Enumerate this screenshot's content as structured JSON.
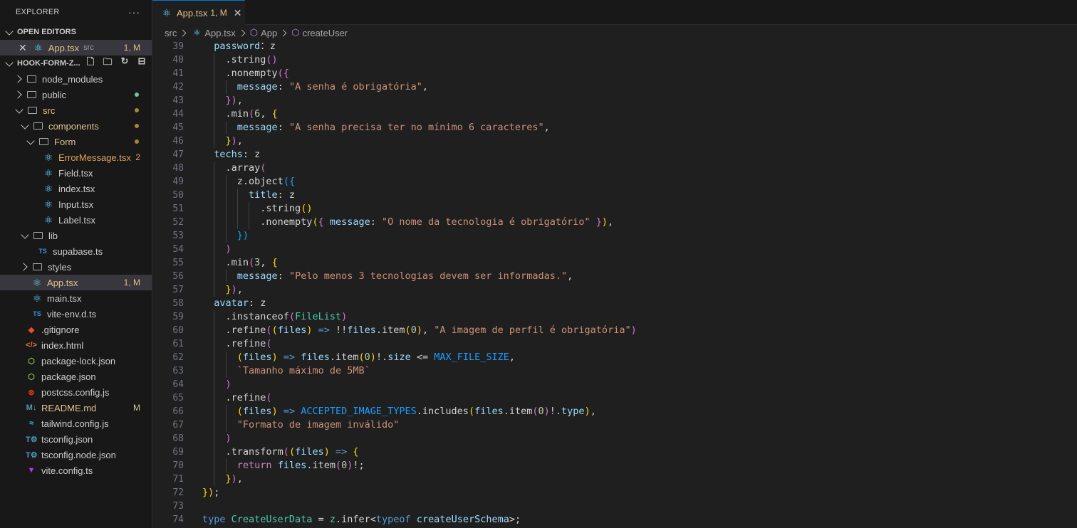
{
  "explorer": {
    "title": "EXPLORER",
    "more": "···",
    "open_editors": {
      "label": "OPEN EDITORS",
      "items": [
        {
          "name": "App.tsx",
          "dir": "src",
          "badge": "1, M"
        }
      ]
    },
    "project": {
      "label": "HOOK-FORM-Z...",
      "tree": [
        {
          "label": "node_modules",
          "depth": 0,
          "kind": "folder-collapsed"
        },
        {
          "label": "public",
          "depth": 0,
          "kind": "folder-collapsed",
          "dot": "#73c991"
        },
        {
          "label": "src",
          "depth": 0,
          "kind": "folder-open",
          "state": "mod",
          "dot": "#a8872f"
        },
        {
          "label": "components",
          "depth": 1,
          "kind": "folder-open",
          "state": "mod",
          "dot": "#a8872f"
        },
        {
          "label": "Form",
          "depth": 2,
          "kind": "folder-open",
          "state": "mod",
          "dot": "#a8872f"
        },
        {
          "label": "ErrorMessage.tsx",
          "depth": 3,
          "kind": "react",
          "state": "err",
          "badge": "2"
        },
        {
          "label": "Field.tsx",
          "depth": 3,
          "kind": "react"
        },
        {
          "label": "index.tsx",
          "depth": 3,
          "kind": "react"
        },
        {
          "label": "Input.tsx",
          "depth": 3,
          "kind": "react"
        },
        {
          "label": "Label.tsx",
          "depth": 3,
          "kind": "react"
        },
        {
          "label": "lib",
          "depth": 1,
          "kind": "folder-open"
        },
        {
          "label": "supabase.ts",
          "depth": 2,
          "kind": "ts",
          "icon": "TS"
        },
        {
          "label": "styles",
          "depth": 1,
          "kind": "folder-collapsed"
        },
        {
          "label": "App.tsx",
          "depth": 1,
          "kind": "react",
          "state": "mod",
          "badge": "1, M",
          "selected": true
        },
        {
          "label": "main.tsx",
          "depth": 1,
          "kind": "react"
        },
        {
          "label": "vite-env.d.ts",
          "depth": 1,
          "kind": "ts",
          "icon": "TS"
        },
        {
          "label": ".gitignore",
          "depth": 0,
          "kind": "file",
          "icon": "◆",
          "color": "#e24e33"
        },
        {
          "label": "index.html",
          "depth": 0,
          "kind": "file",
          "icon": "</>",
          "color": "#e37933"
        },
        {
          "label": "package-lock.json",
          "depth": 0,
          "kind": "file",
          "icon": "⬡",
          "color": "#8dc149"
        },
        {
          "label": "package.json",
          "depth": 0,
          "kind": "file",
          "icon": "⬡",
          "color": "#8dc149"
        },
        {
          "label": "postcss.config.js",
          "depth": 0,
          "kind": "file",
          "icon": "⊛",
          "color": "#dd3a0a"
        },
        {
          "label": "README.md",
          "depth": 0,
          "kind": "file",
          "icon": "M↓",
          "color": "#519aba",
          "state": "mod",
          "badge": "M"
        },
        {
          "label": "tailwind.config.js",
          "depth": 0,
          "kind": "file",
          "icon": "≈",
          "color": "#38bdf8"
        },
        {
          "label": "tsconfig.json",
          "depth": 0,
          "kind": "file",
          "icon": "T⚙",
          "color": "#519aba"
        },
        {
          "label": "tsconfig.node.json",
          "depth": 0,
          "kind": "file",
          "icon": "T⚙",
          "color": "#519aba"
        },
        {
          "label": "vite.config.ts",
          "depth": 0,
          "kind": "file",
          "icon": "▼",
          "color": "#bd34fe"
        }
      ]
    }
  },
  "tab": {
    "label": "App.tsx",
    "extra": "1, M",
    "close": "✕"
  },
  "breadcrumb": [
    "src",
    "App.tsx",
    "App",
    "createUser"
  ],
  "editor": {
    "lines": [
      {
        "n": "39",
        "indent": 1,
        "toks": [
          [
            "p",
            "password"
          ],
          [
            "",
            "："
          ],
          [
            "",
            "z"
          ]
        ]
      },
      {
        "n": "40",
        "indent": 2,
        "toks": [
          [
            "",
            ".string"
          ],
          [
            "m",
            "()"
          ]
        ]
      },
      {
        "n": "41",
        "indent": 2,
        "toks": [
          [
            "",
            ".nonempty"
          ],
          [
            "m",
            "({"
          ]
        ]
      },
      {
        "n": "42",
        "indent": 3,
        "toks": [
          [
            "p",
            "message"
          ],
          [
            "",
            ": "
          ],
          [
            "s",
            "\"A senha é obrigatória\""
          ],
          [
            "",
            ","
          ]
        ]
      },
      {
        "n": "43",
        "indent": 2,
        "toks": [
          [
            "m",
            "})"
          ],
          [
            "",
            ","
          ]
        ]
      },
      {
        "n": "44",
        "indent": 2,
        "toks": [
          [
            "",
            ".min"
          ],
          [
            "m",
            "("
          ],
          [
            "n",
            "6"
          ],
          [
            "",
            ", "
          ],
          [
            "y",
            "{"
          ]
        ]
      },
      {
        "n": "45",
        "indent": 3,
        "toks": [
          [
            "p",
            "message"
          ],
          [
            "",
            ": "
          ],
          [
            "s",
            "\"A senha precisa ter no mínimo 6 caracteres\""
          ],
          [
            "",
            ","
          ]
        ]
      },
      {
        "n": "46",
        "indent": 2,
        "toks": [
          [
            "y",
            "}"
          ],
          [
            "m",
            ")"
          ],
          [
            "",
            ","
          ]
        ]
      },
      {
        "n": "47",
        "indent": 1,
        "toks": [
          [
            "p",
            "techs"
          ],
          [
            "",
            ": z"
          ]
        ]
      },
      {
        "n": "48",
        "indent": 2,
        "toks": [
          [
            "",
            ".array"
          ],
          [
            "m",
            "("
          ]
        ]
      },
      {
        "n": "49",
        "indent": 3,
        "toks": [
          [
            "",
            "z"
          ],
          [
            "",
            ".object"
          ],
          [
            "b",
            "({"
          ]
        ]
      },
      {
        "n": "50",
        "indent": 4,
        "toks": [
          [
            "p",
            "title"
          ],
          [
            "",
            ": z"
          ]
        ]
      },
      {
        "n": "51",
        "indent": 5,
        "toks": [
          [
            "",
            ".string"
          ],
          [
            "y",
            "()"
          ]
        ]
      },
      {
        "n": "52",
        "indent": 5,
        "toks": [
          [
            "",
            ".nonempty"
          ],
          [
            "y",
            "("
          ],
          [
            "m",
            "{"
          ],
          [
            "",
            ""
          ],
          [
            "p",
            " message"
          ],
          [
            "",
            ": "
          ],
          [
            "s",
            "\"O nome da tecnologia é obrigatório\""
          ],
          [
            "m",
            " }"
          ],
          [
            "y",
            ")"
          ],
          [
            "",
            ","
          ]
        ]
      },
      {
        "n": "53",
        "indent": 3,
        "toks": [
          [
            "b",
            "})"
          ]
        ]
      },
      {
        "n": "54",
        "indent": 2,
        "toks": [
          [
            "m",
            ")"
          ]
        ]
      },
      {
        "n": "55",
        "indent": 2,
        "toks": [
          [
            "",
            ".min"
          ],
          [
            "m",
            "("
          ],
          [
            "n",
            "3"
          ],
          [
            "",
            ", "
          ],
          [
            "y",
            "{"
          ]
        ]
      },
      {
        "n": "56",
        "indent": 3,
        "toks": [
          [
            "p",
            "message"
          ],
          [
            "",
            ": "
          ],
          [
            "s",
            "\"Pelo menos 3 tecnologias devem ser informadas.\""
          ],
          [
            "",
            ","
          ]
        ]
      },
      {
        "n": "57",
        "indent": 2,
        "toks": [
          [
            "y",
            "}"
          ],
          [
            "m",
            ")"
          ],
          [
            "",
            ","
          ]
        ]
      },
      {
        "n": "58",
        "indent": 1,
        "toks": [
          [
            "p",
            "avatar"
          ],
          [
            "",
            ": z"
          ]
        ]
      },
      {
        "n": "59",
        "indent": 2,
        "toks": [
          [
            "",
            ".instanceof"
          ],
          [
            "m",
            "("
          ],
          [
            "c",
            "FileList"
          ],
          [
            "m",
            ")"
          ]
        ]
      },
      {
        "n": "60",
        "indent": 2,
        "toks": [
          [
            "",
            ".refine"
          ],
          [
            "m",
            "("
          ],
          [
            "y",
            "("
          ],
          [
            "p",
            "files"
          ],
          [
            "y",
            ")"
          ],
          [
            "k",
            " =>"
          ],
          [
            "",
            " !!"
          ],
          [
            "p",
            "files"
          ],
          [
            "",
            ".item"
          ],
          [
            "y",
            "("
          ],
          [
            "n",
            "0"
          ],
          [
            "y",
            ")"
          ],
          [
            "",
            ", "
          ],
          [
            "s",
            "\"A imagem de perfil é obrigatória\""
          ],
          [
            "m",
            ")"
          ]
        ]
      },
      {
        "n": "61",
        "indent": 2,
        "toks": [
          [
            "",
            ".refine"
          ],
          [
            "m",
            "("
          ]
        ]
      },
      {
        "n": "62",
        "indent": 3,
        "toks": [
          [
            "y",
            "("
          ],
          [
            "p",
            "files"
          ],
          [
            "y",
            ")"
          ],
          [
            "k",
            " =>"
          ],
          [
            "p",
            " files"
          ],
          [
            "",
            ".item"
          ],
          [
            "y",
            "("
          ],
          [
            "n",
            "0"
          ],
          [
            "y",
            ")"
          ],
          [
            "",
            "!."
          ],
          [
            "p",
            "size"
          ],
          [
            "",
            " <= "
          ],
          [
            "b",
            "MAX_FILE_SIZE"
          ],
          [
            "",
            ","
          ]
        ]
      },
      {
        "n": "63",
        "indent": 3,
        "toks": [
          [
            "s",
            "`Tamanho máximo de 5MB`"
          ]
        ]
      },
      {
        "n": "64",
        "indent": 2,
        "toks": [
          [
            "m",
            ")"
          ]
        ]
      },
      {
        "n": "65",
        "indent": 2,
        "toks": [
          [
            "",
            ".refine"
          ],
          [
            "m",
            "("
          ]
        ]
      },
      {
        "n": "66",
        "indent": 3,
        "toks": [
          [
            "y",
            "("
          ],
          [
            "p",
            "files"
          ],
          [
            "y",
            ")"
          ],
          [
            "k",
            " =>"
          ],
          [
            "b",
            " ACCEPTED_IMAGE_TYPES"
          ],
          [
            "",
            ".includes"
          ],
          [
            "y",
            "("
          ],
          [
            "p",
            "files"
          ],
          [
            "",
            ".item"
          ],
          [
            "m",
            "("
          ],
          [
            "n",
            "0"
          ],
          [
            "m",
            ")"
          ],
          [
            "",
            "!."
          ],
          [
            "p",
            "type"
          ],
          [
            "y",
            ")"
          ],
          [
            "",
            ","
          ]
        ]
      },
      {
        "n": "67",
        "indent": 3,
        "toks": [
          [
            "s",
            "\"Formato de imagem inválido\""
          ]
        ]
      },
      {
        "n": "68",
        "indent": 2,
        "toks": [
          [
            "m",
            ")"
          ]
        ]
      },
      {
        "n": "69",
        "indent": 2,
        "toks": [
          [
            "",
            ".transform"
          ],
          [
            "m",
            "("
          ],
          [
            "y",
            "("
          ],
          [
            "p",
            "files"
          ],
          [
            "y",
            ")"
          ],
          [
            "k",
            " =>"
          ],
          [
            "",
            " "
          ],
          [
            "y",
            "{"
          ]
        ]
      },
      {
        "n": "70",
        "indent": 3,
        "toks": [
          [
            "kw",
            "return"
          ],
          [
            "p",
            " files"
          ],
          [
            "",
            ".item"
          ],
          [
            "m",
            "("
          ],
          [
            "n",
            "0"
          ],
          [
            "m",
            ")"
          ],
          [
            "",
            "!;"
          ]
        ]
      },
      {
        "n": "71",
        "indent": 2,
        "toks": [
          [
            "y",
            "}"
          ],
          [
            "m",
            ")"
          ],
          [
            "",
            ","
          ]
        ]
      },
      {
        "n": "72",
        "indent": 0,
        "toks": [
          [
            "y",
            "})"
          ],
          [
            "",
            ";"
          ]
        ]
      },
      {
        "n": "73",
        "indent": 0,
        "toks": []
      },
      {
        "n": "74",
        "indent": 0,
        "toks": [
          [
            "k",
            "type"
          ],
          [
            "c",
            " CreateUserData"
          ],
          [
            "",
            " = "
          ],
          [
            "c",
            "z"
          ],
          [
            "",
            ".infer"
          ],
          [
            "",
            "<"
          ],
          [
            "k",
            "typeof"
          ],
          [
            "p",
            " createUserSchema"
          ],
          [
            "",
            ">;"
          ]
        ]
      }
    ]
  }
}
